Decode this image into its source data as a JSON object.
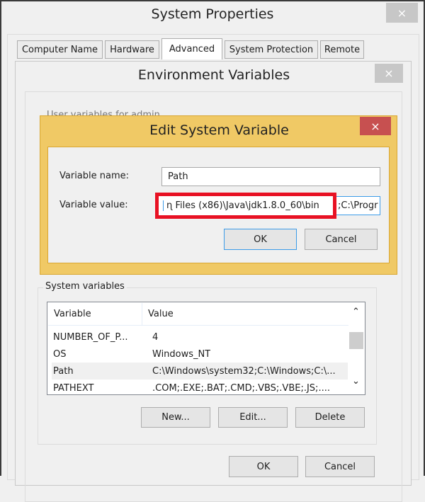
{
  "system_properties": {
    "title": "System Properties",
    "tabs": [
      {
        "label": "Computer Name"
      },
      {
        "label": "Hardware"
      },
      {
        "label": "Advanced",
        "active": true
      },
      {
        "label": "System Protection"
      },
      {
        "label": "Remote"
      }
    ]
  },
  "env_vars": {
    "title": "Environment Variables",
    "user_group_label": "User variables for admin",
    "system_group_label": "System variables",
    "columns": [
      "Variable",
      "Value"
    ],
    "rows": [
      {
        "variable": "NUMBER_OF_P...",
        "value": "4"
      },
      {
        "variable": "OS",
        "value": "Windows_NT"
      },
      {
        "variable": "Path",
        "value": "C:\\Windows\\system32;C:\\Windows;C:\\...",
        "selected": true
      },
      {
        "variable": "PATHEXT",
        "value": ".COM;.EXE;.BAT;.CMD;.VBS;.VBE;.JS;...."
      }
    ],
    "new_label": "New...",
    "edit_label": "Edit...",
    "delete_label": "Delete",
    "ok_label": "OK",
    "cancel_label": "Cancel"
  },
  "edit_dialog": {
    "title": "Edit System Variable",
    "name_label": "Variable name:",
    "name_value": "Path",
    "value_label": "Variable value:",
    "value_highlighted": "ɳ Files (x86)\\Java\\jdk1.8.0_60\\bin",
    "value_rest": ";C:\\Progr",
    "ok_label": "OK",
    "cancel_label": "Cancel",
    "highlight_color": "#e81123",
    "title_bar_color": "#f0c965",
    "close_color": "#c75050"
  },
  "icons": {
    "close": "×",
    "scroll_up": "⌃",
    "scroll_down": "⌄"
  }
}
